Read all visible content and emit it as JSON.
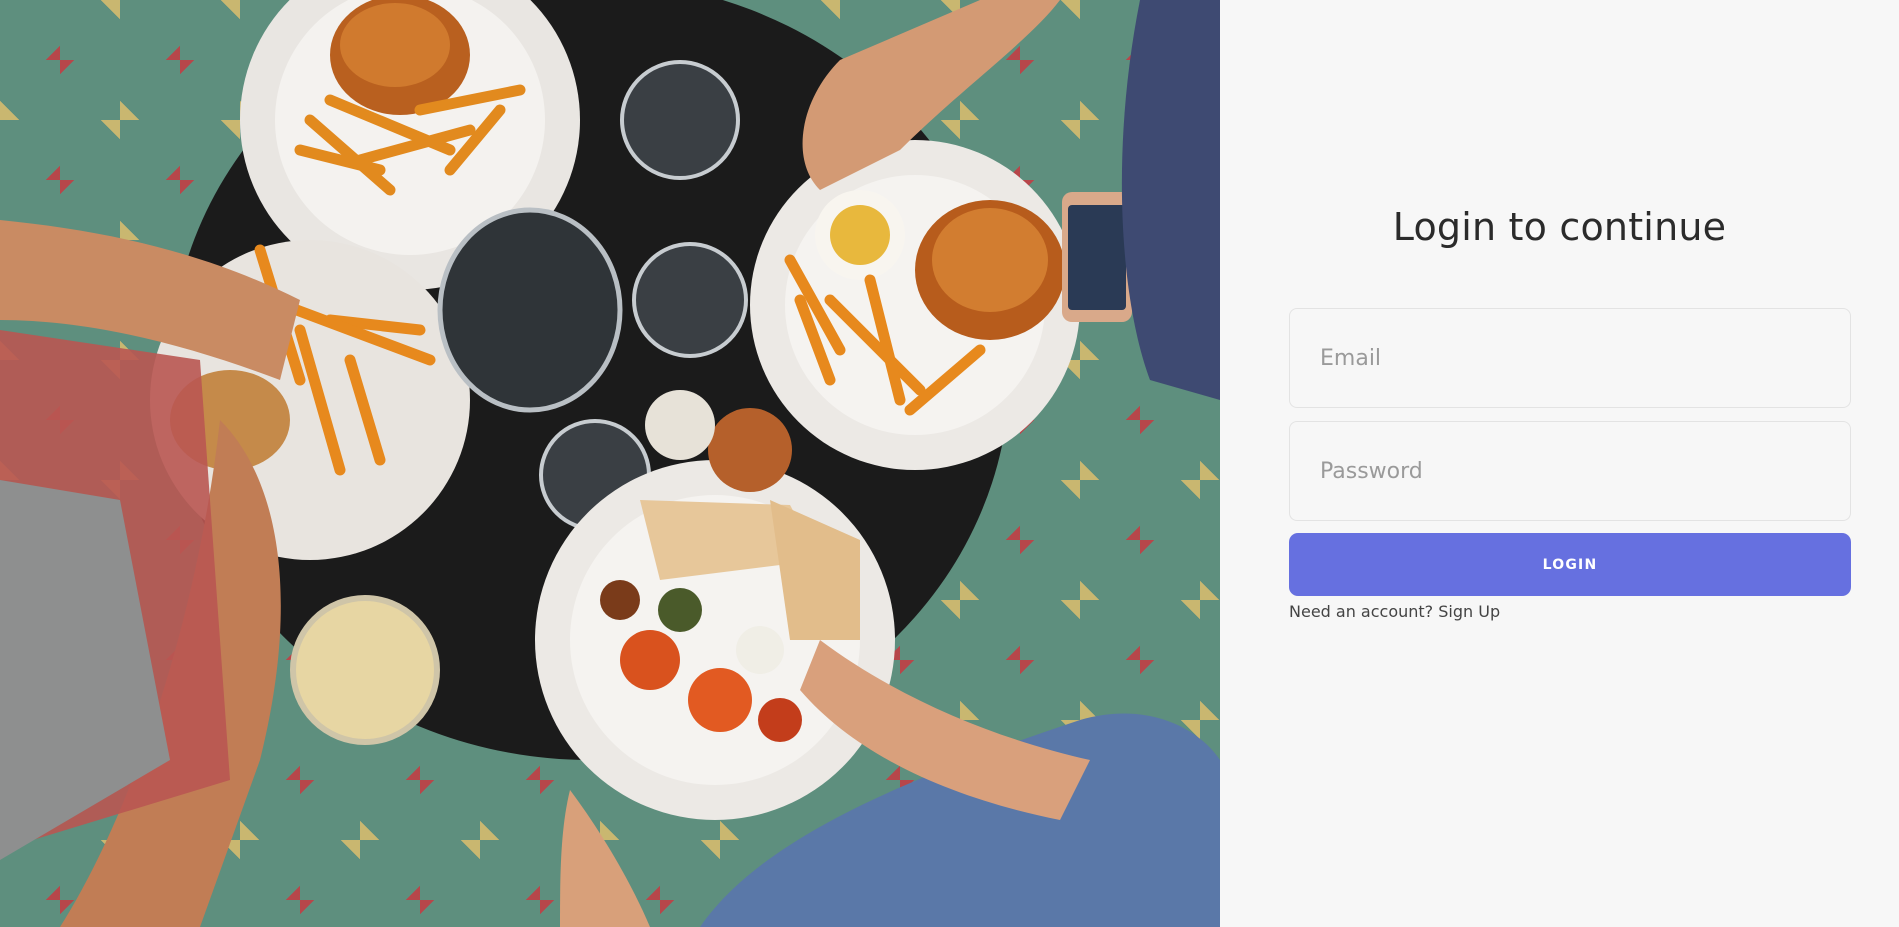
{
  "login": {
    "title": "Login to continue",
    "email_placeholder": "Email",
    "password_placeholder": "Password",
    "login_label": "LOGIN",
    "signup_prompt": "Need an account?",
    "signup_link": "Sign Up"
  },
  "colors": {
    "accent": "#6670e0",
    "panel_background": "#f7f7f7",
    "title_text": "#2b2b2b"
  }
}
